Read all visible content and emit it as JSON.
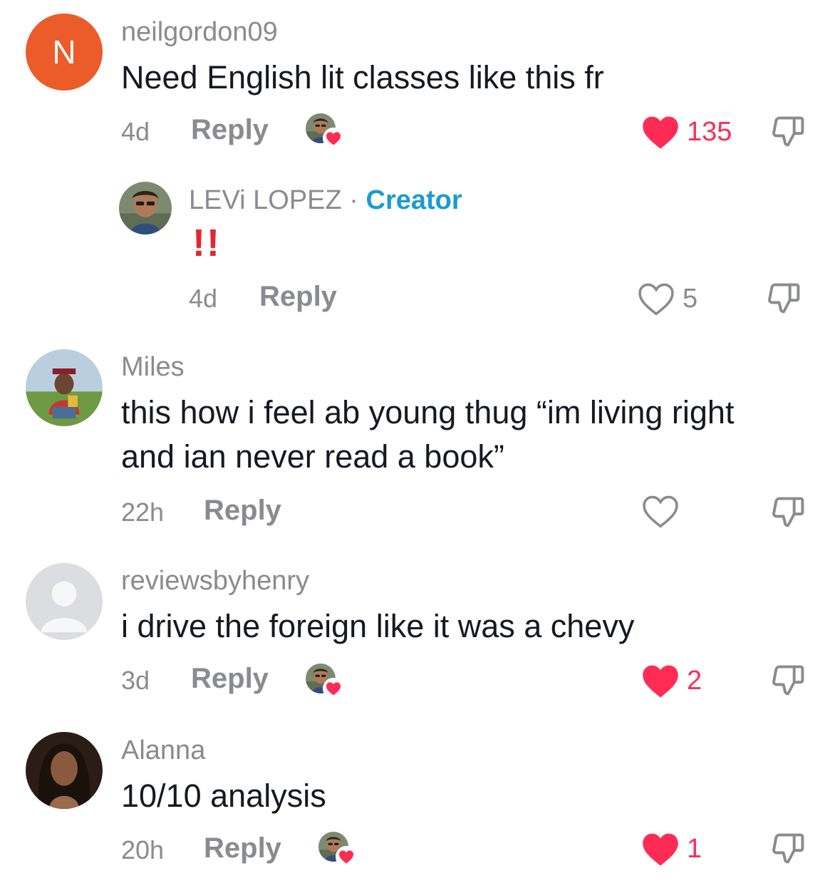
{
  "comments": [
    {
      "username": "neilgordon09",
      "avatar_letter": "N",
      "avatar_color": "#ec5b2a",
      "text": "Need English lit classes like this fr",
      "time": "4d",
      "reply_label": "Reply",
      "liked_by_creator": true,
      "likes": "135",
      "liked": true
    },
    {
      "username": "LEVi LOPEZ",
      "separator": "·",
      "creator_label": "Creator",
      "text": "!!",
      "time": "4d",
      "reply_label": "Reply",
      "likes": "5",
      "liked": false
    },
    {
      "username": "Miles",
      "text_line1": "this how i feel ab young thug “im living right",
      "text_line2": "and ian never read a book”",
      "time": "22h",
      "reply_label": "Reply",
      "liked": false
    },
    {
      "username": "reviewsbyhenry",
      "text": "i drive the foreign like it was a chevy",
      "time": "3d",
      "reply_label": "Reply",
      "liked_by_creator": true,
      "likes": "2",
      "liked": true
    },
    {
      "username": "Alanna",
      "text": "10/10 analysis",
      "time": "20h",
      "reply_label": "Reply",
      "liked_by_creator": true,
      "likes": "1",
      "liked": true
    }
  ],
  "colors": {
    "like_red": "#fe2c55",
    "creator_blue": "#1a9bd1",
    "meta_grey": "#8a8b91"
  },
  "icons": [
    "heart-icon",
    "heart-outline-icon",
    "dislike-icon",
    "creator-liked-badge-icon"
  ]
}
